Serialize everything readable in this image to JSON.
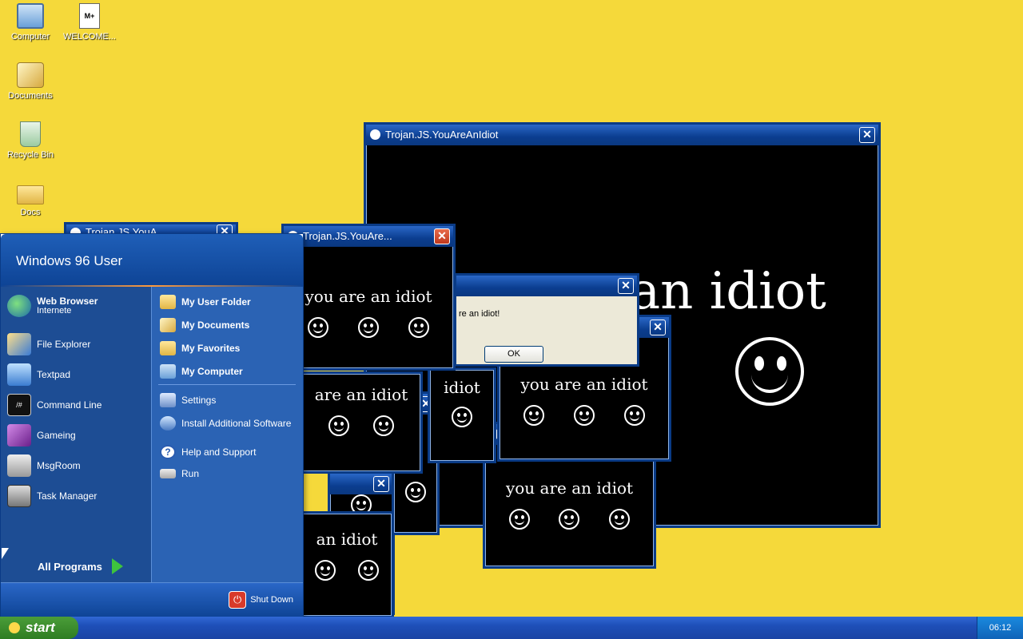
{
  "desktop": {
    "icons": [
      {
        "label": "Computer",
        "icon": "computer-icon"
      },
      {
        "label": "WELCOME...",
        "icon": "markdown-file-icon"
      },
      {
        "label": "Documents",
        "icon": "documents-icon"
      },
      {
        "label": "Recycle Bin",
        "icon": "recycle-bin-icon"
      },
      {
        "label": "Docs",
        "icon": "folder-icon"
      }
    ]
  },
  "windows": {
    "main": {
      "title": "Trojan.JS.YouAreAnIdiot",
      "text": "an idiot"
    },
    "small": {
      "title": "Trojan.JS.YouAre...",
      "text": "you are an idiot"
    },
    "back": {
      "title": "Trojan.JS.YouA..."
    },
    "repeat_text": "you are an idiot",
    "partial_text": "are an idiot",
    "partial_text2": "an idiot",
    "partial_text3": "idiot"
  },
  "dialog": {
    "message": "re an idiot!",
    "ok_label": "OK"
  },
  "start_menu": {
    "user": "Windows 96 User",
    "left_items": [
      {
        "label": "Web Browser",
        "sub": "Internete",
        "icon": "globe-icon"
      },
      {
        "label": "File Explorer",
        "icon": "file-explorer-icon"
      },
      {
        "label": "Textpad",
        "icon": "textpad-icon"
      },
      {
        "label": "Command Line",
        "icon": "terminal-icon"
      },
      {
        "label": "Gameing",
        "icon": "game-cube-icon"
      },
      {
        "label": "MsgRoom",
        "icon": "chat-icon"
      },
      {
        "label": "Task Manager",
        "icon": "task-manager-icon"
      }
    ],
    "right_items": [
      {
        "label": "My User Folder",
        "icon": "folder-icon"
      },
      {
        "label": "My Documents",
        "icon": "documents-icon"
      },
      {
        "label": "My Favorites",
        "icon": "folder-icon"
      },
      {
        "label": "My Computer",
        "icon": "computer-icon"
      },
      {
        "label": "Settings",
        "icon": "settings-icon"
      },
      {
        "label": "Install Additional Software",
        "icon": "install-icon"
      },
      {
        "label": "Help and Support",
        "icon": "help-icon"
      },
      {
        "label": "Run",
        "icon": "run-icon"
      }
    ],
    "all_programs": "All Programs",
    "shutdown": "Shut Down"
  },
  "taskbar": {
    "start_label": "start",
    "clock": "06:12"
  },
  "colors": {
    "desktop": "#f5d93a",
    "titlebar": "#0b3d8f",
    "start_green": "#3a8a2e"
  }
}
